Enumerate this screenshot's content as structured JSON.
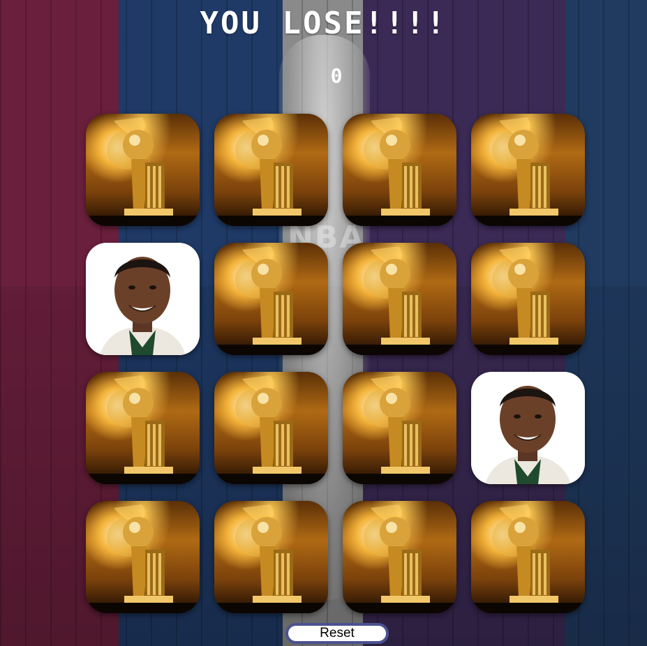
{
  "status_text": "YOU LOSE!!!!",
  "score": "0",
  "reset_label": "Reset",
  "card_back_image": "trophy",
  "card_face_image": "player-portrait",
  "cards": [
    {
      "face": "back"
    },
    {
      "face": "back"
    },
    {
      "face": "back"
    },
    {
      "face": "back"
    },
    {
      "face": "player"
    },
    {
      "face": "back"
    },
    {
      "face": "back"
    },
    {
      "face": "back"
    },
    {
      "face": "back"
    },
    {
      "face": "back"
    },
    {
      "face": "back"
    },
    {
      "face": "player"
    },
    {
      "face": "back"
    },
    {
      "face": "back"
    },
    {
      "face": "back"
    },
    {
      "face": "back"
    }
  ],
  "colors": {
    "text": "#ffffff",
    "reset_border": "#4b5290"
  }
}
